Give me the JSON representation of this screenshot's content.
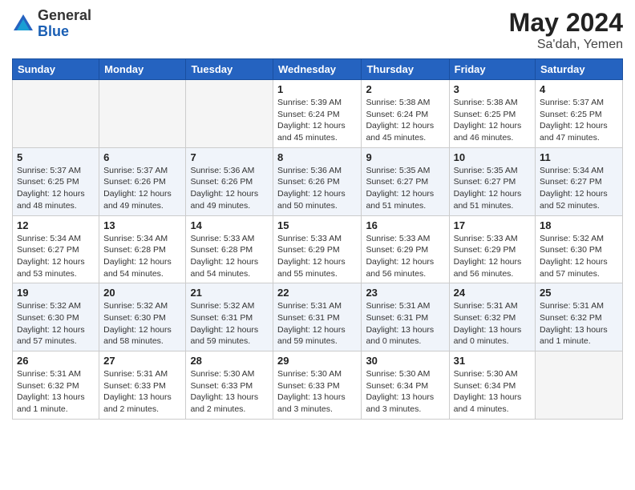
{
  "header": {
    "logo_general": "General",
    "logo_blue": "Blue",
    "month_year": "May 2024",
    "location": "Sa'dah, Yemen"
  },
  "days_of_week": [
    "Sunday",
    "Monday",
    "Tuesday",
    "Wednesday",
    "Thursday",
    "Friday",
    "Saturday"
  ],
  "weeks": [
    [
      {
        "day": "",
        "info": ""
      },
      {
        "day": "",
        "info": ""
      },
      {
        "day": "",
        "info": ""
      },
      {
        "day": "1",
        "info": "Sunrise: 5:39 AM\nSunset: 6:24 PM\nDaylight: 12 hours\nand 45 minutes."
      },
      {
        "day": "2",
        "info": "Sunrise: 5:38 AM\nSunset: 6:24 PM\nDaylight: 12 hours\nand 45 minutes."
      },
      {
        "day": "3",
        "info": "Sunrise: 5:38 AM\nSunset: 6:25 PM\nDaylight: 12 hours\nand 46 minutes."
      },
      {
        "day": "4",
        "info": "Sunrise: 5:37 AM\nSunset: 6:25 PM\nDaylight: 12 hours\nand 47 minutes."
      }
    ],
    [
      {
        "day": "5",
        "info": "Sunrise: 5:37 AM\nSunset: 6:25 PM\nDaylight: 12 hours\nand 48 minutes."
      },
      {
        "day": "6",
        "info": "Sunrise: 5:37 AM\nSunset: 6:26 PM\nDaylight: 12 hours\nand 49 minutes."
      },
      {
        "day": "7",
        "info": "Sunrise: 5:36 AM\nSunset: 6:26 PM\nDaylight: 12 hours\nand 49 minutes."
      },
      {
        "day": "8",
        "info": "Sunrise: 5:36 AM\nSunset: 6:26 PM\nDaylight: 12 hours\nand 50 minutes."
      },
      {
        "day": "9",
        "info": "Sunrise: 5:35 AM\nSunset: 6:27 PM\nDaylight: 12 hours\nand 51 minutes."
      },
      {
        "day": "10",
        "info": "Sunrise: 5:35 AM\nSunset: 6:27 PM\nDaylight: 12 hours\nand 51 minutes."
      },
      {
        "day": "11",
        "info": "Sunrise: 5:34 AM\nSunset: 6:27 PM\nDaylight: 12 hours\nand 52 minutes."
      }
    ],
    [
      {
        "day": "12",
        "info": "Sunrise: 5:34 AM\nSunset: 6:27 PM\nDaylight: 12 hours\nand 53 minutes."
      },
      {
        "day": "13",
        "info": "Sunrise: 5:34 AM\nSunset: 6:28 PM\nDaylight: 12 hours\nand 54 minutes."
      },
      {
        "day": "14",
        "info": "Sunrise: 5:33 AM\nSunset: 6:28 PM\nDaylight: 12 hours\nand 54 minutes."
      },
      {
        "day": "15",
        "info": "Sunrise: 5:33 AM\nSunset: 6:29 PM\nDaylight: 12 hours\nand 55 minutes."
      },
      {
        "day": "16",
        "info": "Sunrise: 5:33 AM\nSunset: 6:29 PM\nDaylight: 12 hours\nand 56 minutes."
      },
      {
        "day": "17",
        "info": "Sunrise: 5:33 AM\nSunset: 6:29 PM\nDaylight: 12 hours\nand 56 minutes."
      },
      {
        "day": "18",
        "info": "Sunrise: 5:32 AM\nSunset: 6:30 PM\nDaylight: 12 hours\nand 57 minutes."
      }
    ],
    [
      {
        "day": "19",
        "info": "Sunrise: 5:32 AM\nSunset: 6:30 PM\nDaylight: 12 hours\nand 57 minutes."
      },
      {
        "day": "20",
        "info": "Sunrise: 5:32 AM\nSunset: 6:30 PM\nDaylight: 12 hours\nand 58 minutes."
      },
      {
        "day": "21",
        "info": "Sunrise: 5:32 AM\nSunset: 6:31 PM\nDaylight: 12 hours\nand 59 minutes."
      },
      {
        "day": "22",
        "info": "Sunrise: 5:31 AM\nSunset: 6:31 PM\nDaylight: 12 hours\nand 59 minutes."
      },
      {
        "day": "23",
        "info": "Sunrise: 5:31 AM\nSunset: 6:31 PM\nDaylight: 13 hours\nand 0 minutes."
      },
      {
        "day": "24",
        "info": "Sunrise: 5:31 AM\nSunset: 6:32 PM\nDaylight: 13 hours\nand 0 minutes."
      },
      {
        "day": "25",
        "info": "Sunrise: 5:31 AM\nSunset: 6:32 PM\nDaylight: 13 hours\nand 1 minute."
      }
    ],
    [
      {
        "day": "26",
        "info": "Sunrise: 5:31 AM\nSunset: 6:32 PM\nDaylight: 13 hours\nand 1 minute."
      },
      {
        "day": "27",
        "info": "Sunrise: 5:31 AM\nSunset: 6:33 PM\nDaylight: 13 hours\nand 2 minutes."
      },
      {
        "day": "28",
        "info": "Sunrise: 5:30 AM\nSunset: 6:33 PM\nDaylight: 13 hours\nand 2 minutes."
      },
      {
        "day": "29",
        "info": "Sunrise: 5:30 AM\nSunset: 6:33 PM\nDaylight: 13 hours\nand 3 minutes."
      },
      {
        "day": "30",
        "info": "Sunrise: 5:30 AM\nSunset: 6:34 PM\nDaylight: 13 hours\nand 3 minutes."
      },
      {
        "day": "31",
        "info": "Sunrise: 5:30 AM\nSunset: 6:34 PM\nDaylight: 13 hours\nand 4 minutes."
      },
      {
        "day": "",
        "info": ""
      }
    ]
  ]
}
